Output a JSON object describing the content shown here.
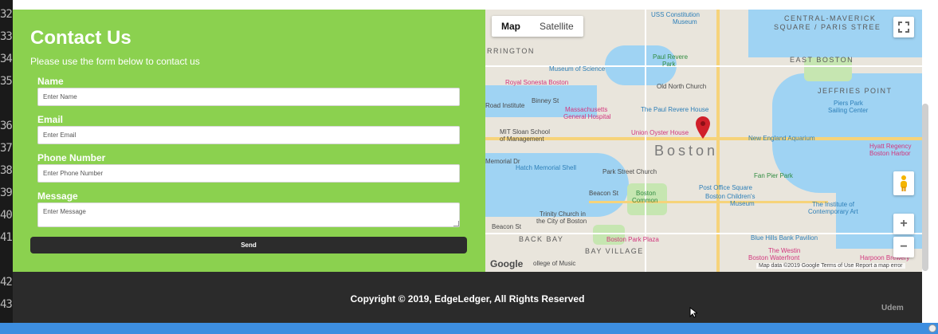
{
  "gutter": [
    "32",
    "33",
    "34",
    "35",
    "36",
    "37",
    "38",
    "39",
    "40",
    "41",
    "42",
    "43"
  ],
  "contact": {
    "title": "Contact Us",
    "subtitle": "Please use the form below to contact us",
    "fields": [
      {
        "label": "Name",
        "placeholder": "Enter Name"
      },
      {
        "label": "Email",
        "placeholder": "Enter Email"
      },
      {
        "label": "Phone Number",
        "placeholder": "Enter Phone Number"
      },
      {
        "label": "Message",
        "placeholder": "Enter Message"
      }
    ],
    "send_label": "Send"
  },
  "map": {
    "tabs": [
      "Map",
      "Satellite"
    ],
    "labels": {
      "uss": "USS Constitution",
      "museum": "Museum",
      "cmsq1": "CENTRAL-MAVERICK",
      "cmsq2": "SQUARE / PARIS STREE",
      "rrington": "RRINGTON",
      "mos": "Museum of Science",
      "prh1": "Paul Revere",
      "prh2": "Park",
      "eastboston": "EAST BOSTON",
      "royal": "Royal Sonesta Boston",
      "onc": "Old North Church",
      "jp": "JEFFRIES POINT",
      "piers1": "Piers Park",
      "piers2": "Sailing Center",
      "road": "Road Institute",
      "binney": "Binney St",
      "mgh1": "Massachusetts",
      "mgh2": "General Hospital",
      "prh": "The Paul Revere House",
      "mit1": "MIT Sloan School",
      "mit2": "of Management",
      "union": "Union Oyster House",
      "boston": "Boston",
      "nea": "New England Aquarium",
      "hyatt1": "Hyatt Regency",
      "hyatt2": "Boston Harbor",
      "memorial": "Memorial Dr",
      "hatch": "Hatch Memorial Shell",
      "psc": "Park Street Church",
      "fpp": "Fan Pier Park",
      "bc1": "Boston",
      "bc2": "Common",
      "pos": "Post Office Square",
      "bcm1": "Boston Children's",
      "bcm2": "Museum",
      "beacon": "Beacon St",
      "tca1": "The Institute of",
      "tca2": "Contemporary Art",
      "trinity1": "Trinity Church in",
      "trinity2": "the City of Boston",
      "backbay": "BACK BAY",
      "bpp": "Boston Park Plaza",
      "bluehills": "Blue Hills Bank Pavilion",
      "bayvillage": "BAY VILLAGE",
      "westin1": "The Westin",
      "westin2": "Boston Waterfront",
      "harpoon": "Harpoon Brewery",
      "college": "ollege of Music",
      "beacon2": "Beacon St"
    },
    "google": "Google",
    "footer": "Map data ©2019 Google   Terms of Use   Report a map error"
  },
  "footer": {
    "copyright": "Copyright © 2019, EdgeLedger, All Rights Reserved",
    "udemy": "Udem"
  }
}
